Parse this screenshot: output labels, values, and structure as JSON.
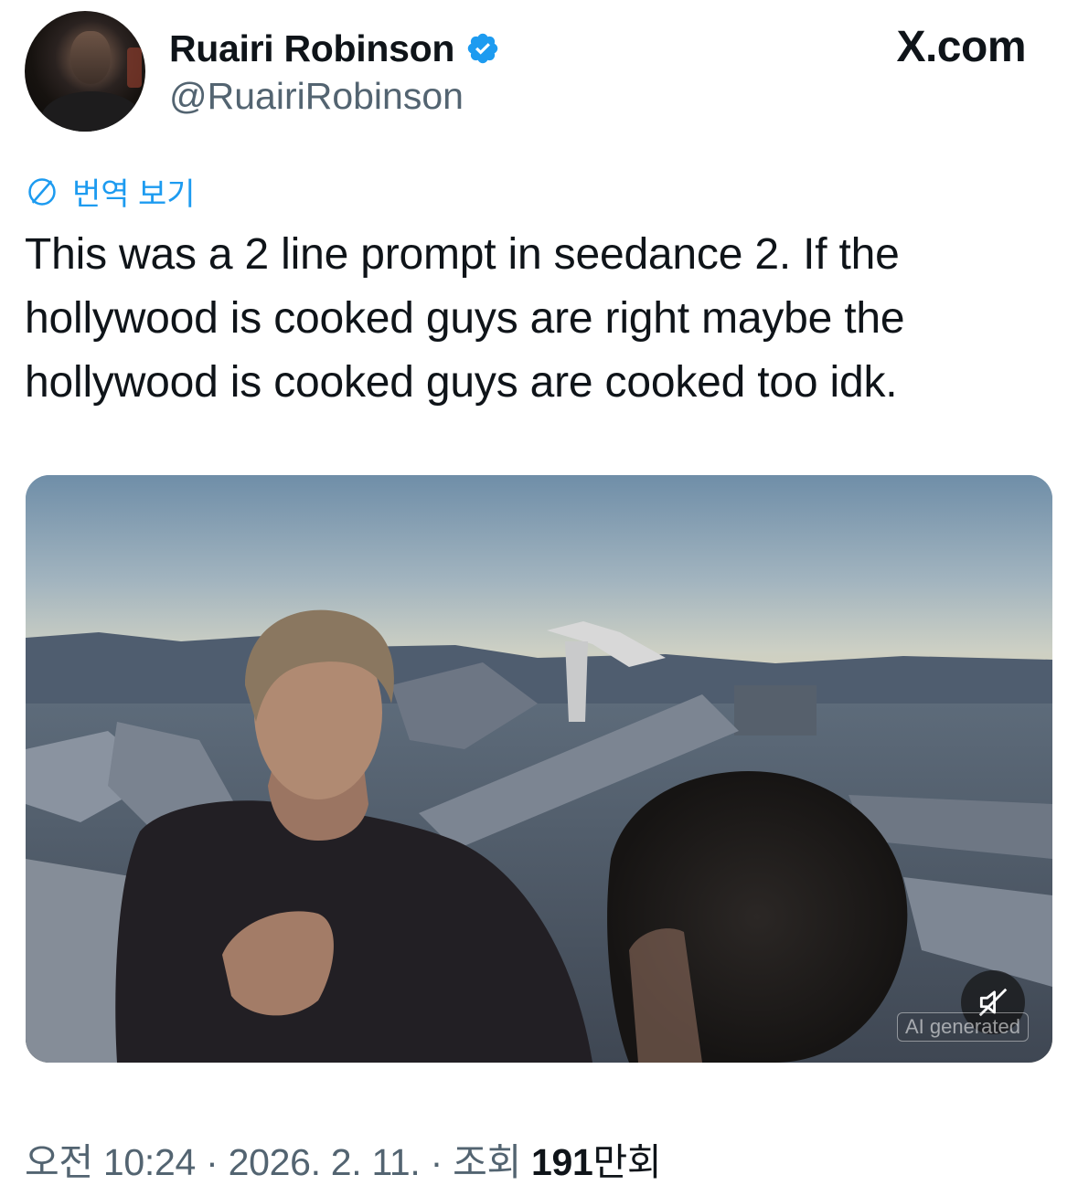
{
  "header": {
    "display_name": "Ruairi Robinson",
    "handle": "@RuairiRobinson",
    "brand": "X.com",
    "verified_color": "#1d9bf0"
  },
  "translate": {
    "label": "번역 보기",
    "icon": "globe-icon"
  },
  "tweet": {
    "text": "This was a 2 line prompt in seedance 2. If the hollywood is cooked guys are right maybe the hollywood is cooked guys are cooked too idk."
  },
  "media": {
    "badge": "AI generated",
    "mute_icon": "speaker-muted-icon"
  },
  "meta": {
    "time": "오전 10:24",
    "separator": "·",
    "date": "2026. 2. 11.",
    "views_label": "조회",
    "views_count": "191",
    "views_unit": "만회"
  },
  "colors": {
    "link": "#1d9bf0",
    "secondary_text": "#536471",
    "primary_text": "#0f1419"
  }
}
